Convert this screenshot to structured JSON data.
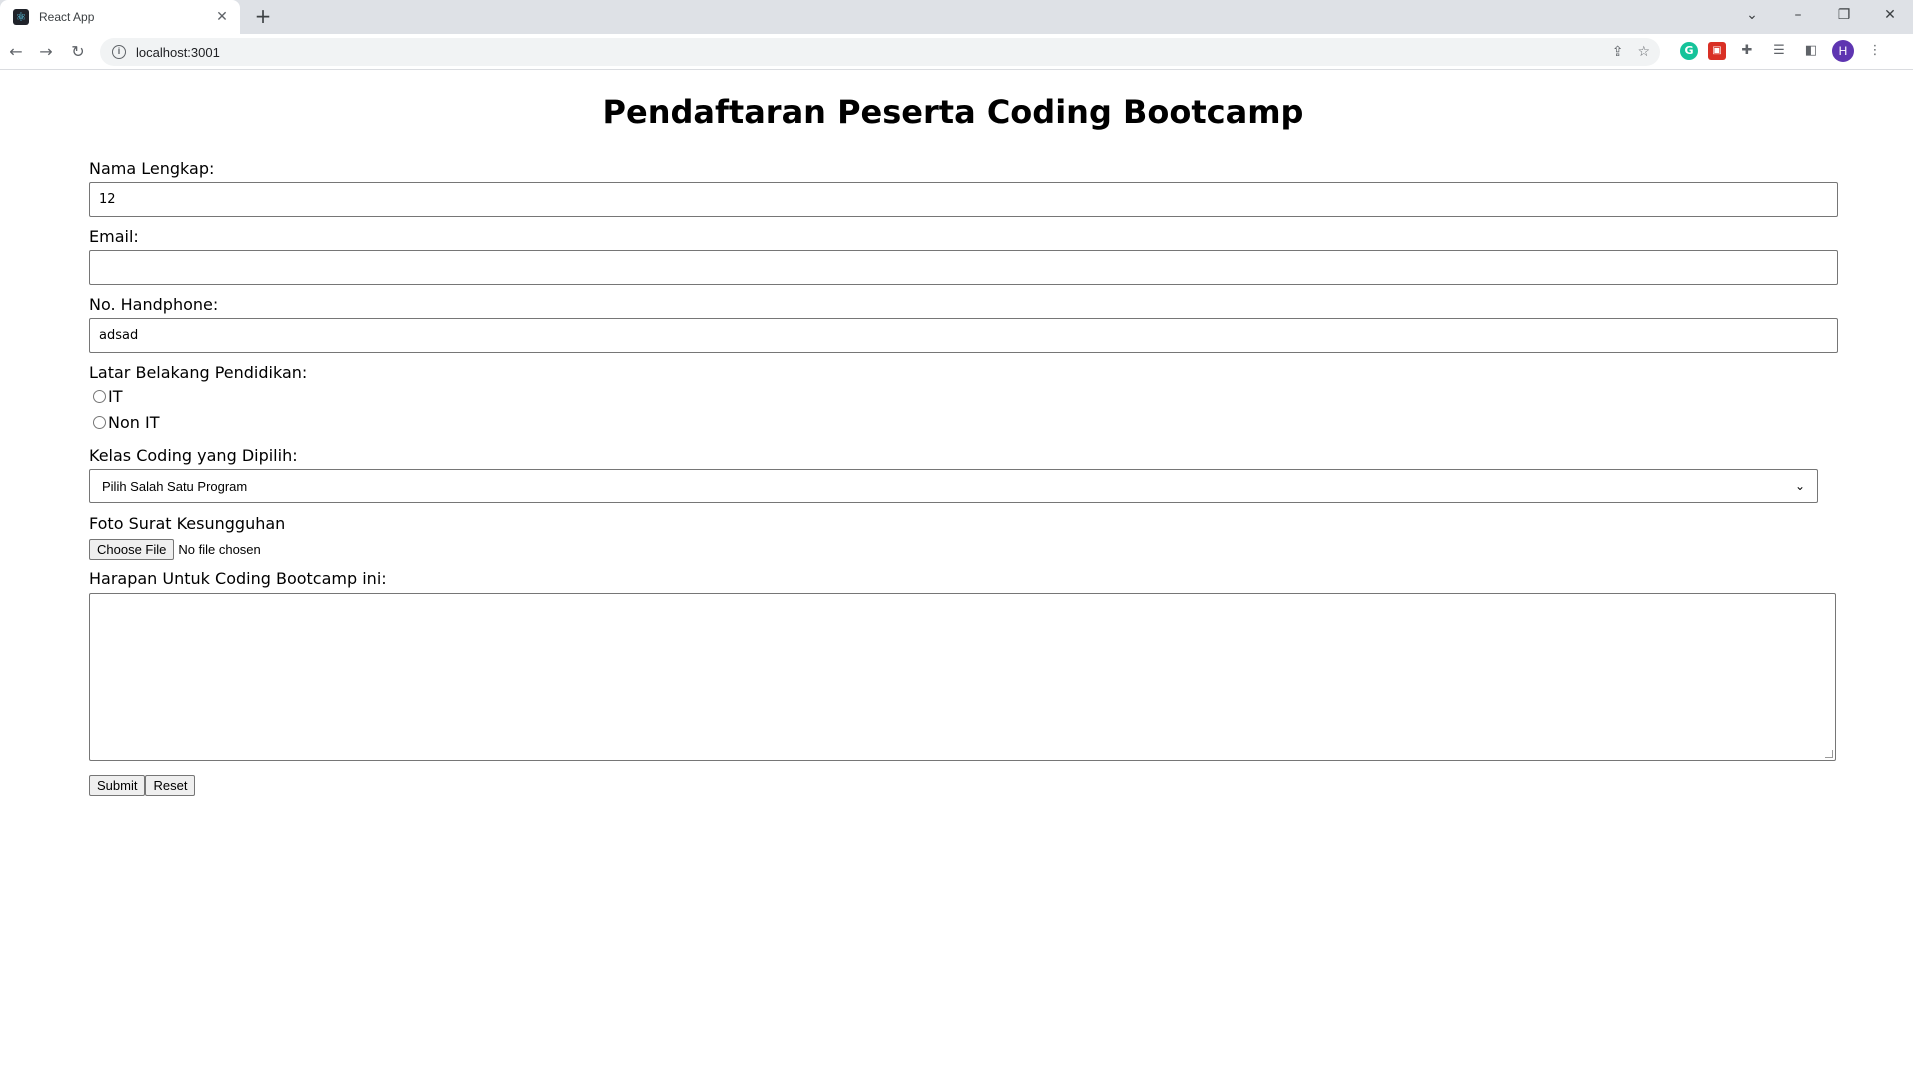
{
  "browser": {
    "tab_title": "React App",
    "url": "localhost:3001",
    "avatar_letter": "H"
  },
  "form": {
    "title": "Pendaftaran Peserta Coding Bootcamp",
    "nama_label": "Nama Lengkap:",
    "nama_value": "12",
    "email_label": "Email:",
    "email_value": "",
    "hp_label": "No. Handphone:",
    "hp_value": "adsad",
    "pendidikan_label": "Latar Belakang Pendidikan:",
    "pendidikan_options": [
      "IT",
      "Non IT"
    ],
    "kelas_label": "Kelas Coding yang Dipilih:",
    "kelas_value": "Pilih Salah Satu Program",
    "foto_label": "Foto Surat Kesungguhan",
    "choose_file_label": "Choose File",
    "file_status": "No file chosen",
    "harapan_label": "Harapan Untuk Coding Bootcamp ini:",
    "harapan_value": "",
    "submit_label": "Submit",
    "reset_label": "Reset"
  }
}
